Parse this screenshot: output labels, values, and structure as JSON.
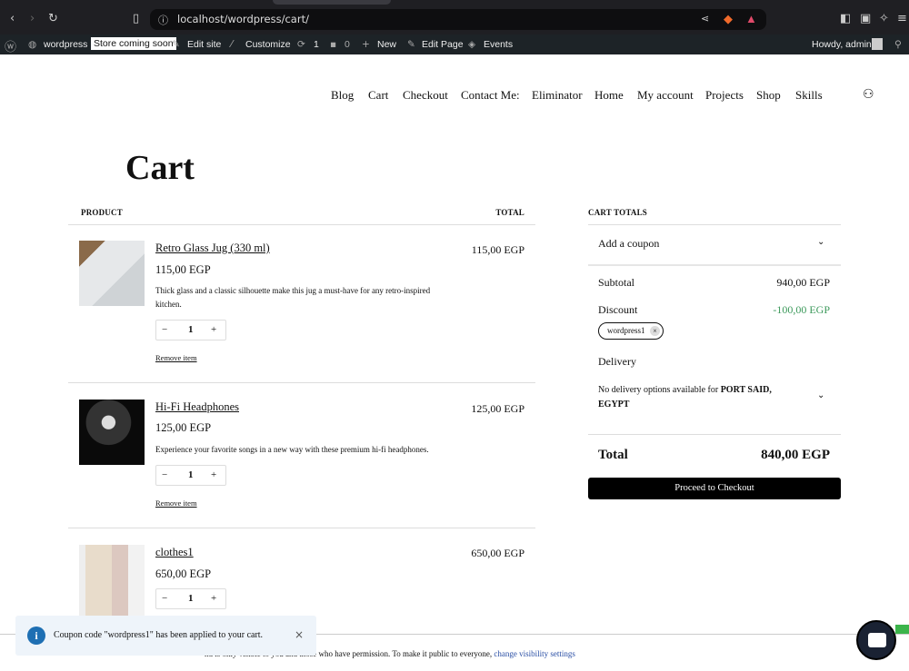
{
  "browser": {
    "url": "localhost/wordpress/cart/"
  },
  "adminbar": {
    "site": "wordpress",
    "store_badge": "Store coming soon",
    "edit_site": "Edit site",
    "customize": "Customize",
    "updates": "1",
    "comments": "0",
    "new": "New",
    "edit_page": "Edit Page",
    "events": "Events",
    "howdy": "Howdy, admin"
  },
  "nav": [
    "Blog",
    "Cart",
    "Checkout",
    "Contact Me:",
    "Eliminator",
    "Home",
    "My account",
    "Projects",
    "Shop",
    "Skills"
  ],
  "page_title": "Cart",
  "table": {
    "product_header": "PRODUCT",
    "total_header": "TOTAL"
  },
  "items": [
    {
      "name": "Retro Glass Jug (330 ml)",
      "price": "115,00 EGP",
      "description": "Thick glass and a classic silhouette make this jug a must-have for any retro-inspired kitchen.",
      "qty": "1",
      "remove": "Remove item",
      "total": "115,00 EGP"
    },
    {
      "name": "Hi-Fi Headphones",
      "price": "125,00 EGP",
      "description": "Experience your favorite songs in a new way with these premium hi-fi headphones.",
      "qty": "1",
      "remove": "Remove item",
      "total": "125,00 EGP"
    },
    {
      "name": "clothes1",
      "price": "650,00 EGP",
      "qty": "1",
      "total": "650,00 EGP"
    }
  ],
  "totals": {
    "header": "CART TOTALS",
    "coupon": "Add a coupon",
    "subtotal_label": "Subtotal",
    "subtotal": "940,00 EGP",
    "discount_label": "Discount",
    "discount": "-100,00 EGP",
    "coupon_code": "wordpress1",
    "delivery_label": "Delivery",
    "delivery_text": "No delivery options available for ",
    "delivery_location": "PORT SAID, EGYPT",
    "total_label": "Total",
    "total": "840,00 EGP",
    "checkout": "Proceed to Checkout",
    "discount_color": "#3d9a5c"
  },
  "notice": {
    "text": "nd is only visible to you and those who have permission. To make it public to everyone, ",
    "link": "change visibility settings"
  },
  "toast": {
    "text": "Coupon code \"wordpress1\" has been applied to your cart."
  }
}
